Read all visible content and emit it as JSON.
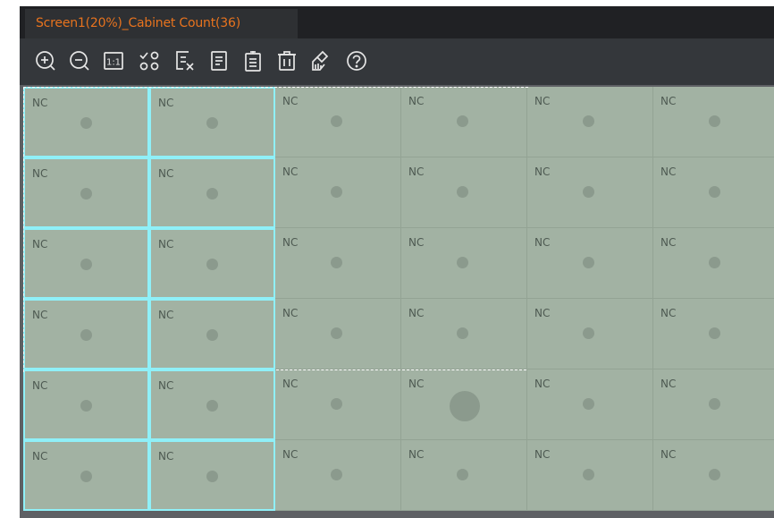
{
  "tab": {
    "title": "Screen1(20%)_Cabinet Count(36)"
  },
  "toolbar": {
    "buttons": [
      {
        "name": "zoom-in",
        "icon": "zoom-in-icon"
      },
      {
        "name": "zoom-out",
        "icon": "zoom-out-icon"
      },
      {
        "name": "actual-size",
        "icon": "actual-size-icon",
        "label": "1:1"
      },
      {
        "name": "layout",
        "icon": "layout-icon"
      },
      {
        "name": "clear",
        "icon": "clear-icon"
      },
      {
        "name": "copy",
        "icon": "copy-icon"
      },
      {
        "name": "paste",
        "icon": "paste-icon"
      },
      {
        "name": "delete",
        "icon": "delete-icon"
      },
      {
        "name": "clean",
        "icon": "brush-icon"
      },
      {
        "name": "help",
        "icon": "help-icon"
      }
    ]
  },
  "grid": {
    "rows": 6,
    "cols": 6,
    "cell_label": "NC",
    "selected_columns": [
      0,
      1
    ],
    "large_dot_cell": {
      "row": 4,
      "col": 3
    }
  },
  "colors": {
    "tab_text": "#e8731e",
    "cabinet_fill": "#a2b2a3",
    "selection_border": "#8ff0f8",
    "background": "#2b2d30"
  }
}
